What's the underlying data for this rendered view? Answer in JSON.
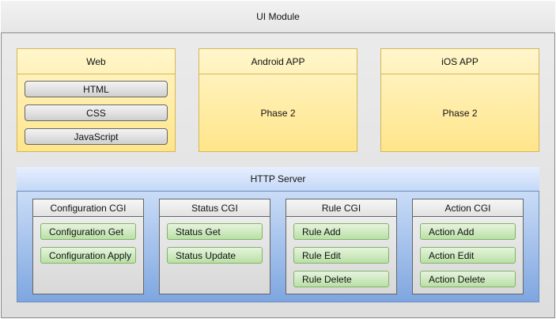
{
  "ui_module": {
    "title": "UI Module"
  },
  "web": {
    "title": "Web",
    "items": [
      "HTML",
      "CSS",
      "JavaScript"
    ]
  },
  "android": {
    "title": "Android APP",
    "body": "Phase 2"
  },
  "ios": {
    "title": "iOS APP",
    "body": "Phase 2"
  },
  "http_server": {
    "title": "HTTP Server",
    "cgis": [
      {
        "title": "Configuration CGI",
        "items": [
          "Configuration Get",
          "Configuration Apply"
        ]
      },
      {
        "title": "Status CGI",
        "items": [
          "Status Get",
          "Status Update"
        ]
      },
      {
        "title": "Rule CGI",
        "items": [
          "Rule Add",
          "Rule Edit",
          "Rule Delete"
        ]
      },
      {
        "title": "Action CGI",
        "items": [
          "Action Add",
          "Action Edit",
          "Action Delete"
        ]
      }
    ]
  },
  "colors": {
    "yellow_fill": "#fff2cc",
    "yellow_stroke": "#d6b656",
    "blue_fill": "#dae8fc",
    "blue_stroke": "#6c8ebf",
    "green_fill": "#d5e8d4",
    "green_stroke": "#82b366",
    "grey_stroke": "#666666"
  }
}
